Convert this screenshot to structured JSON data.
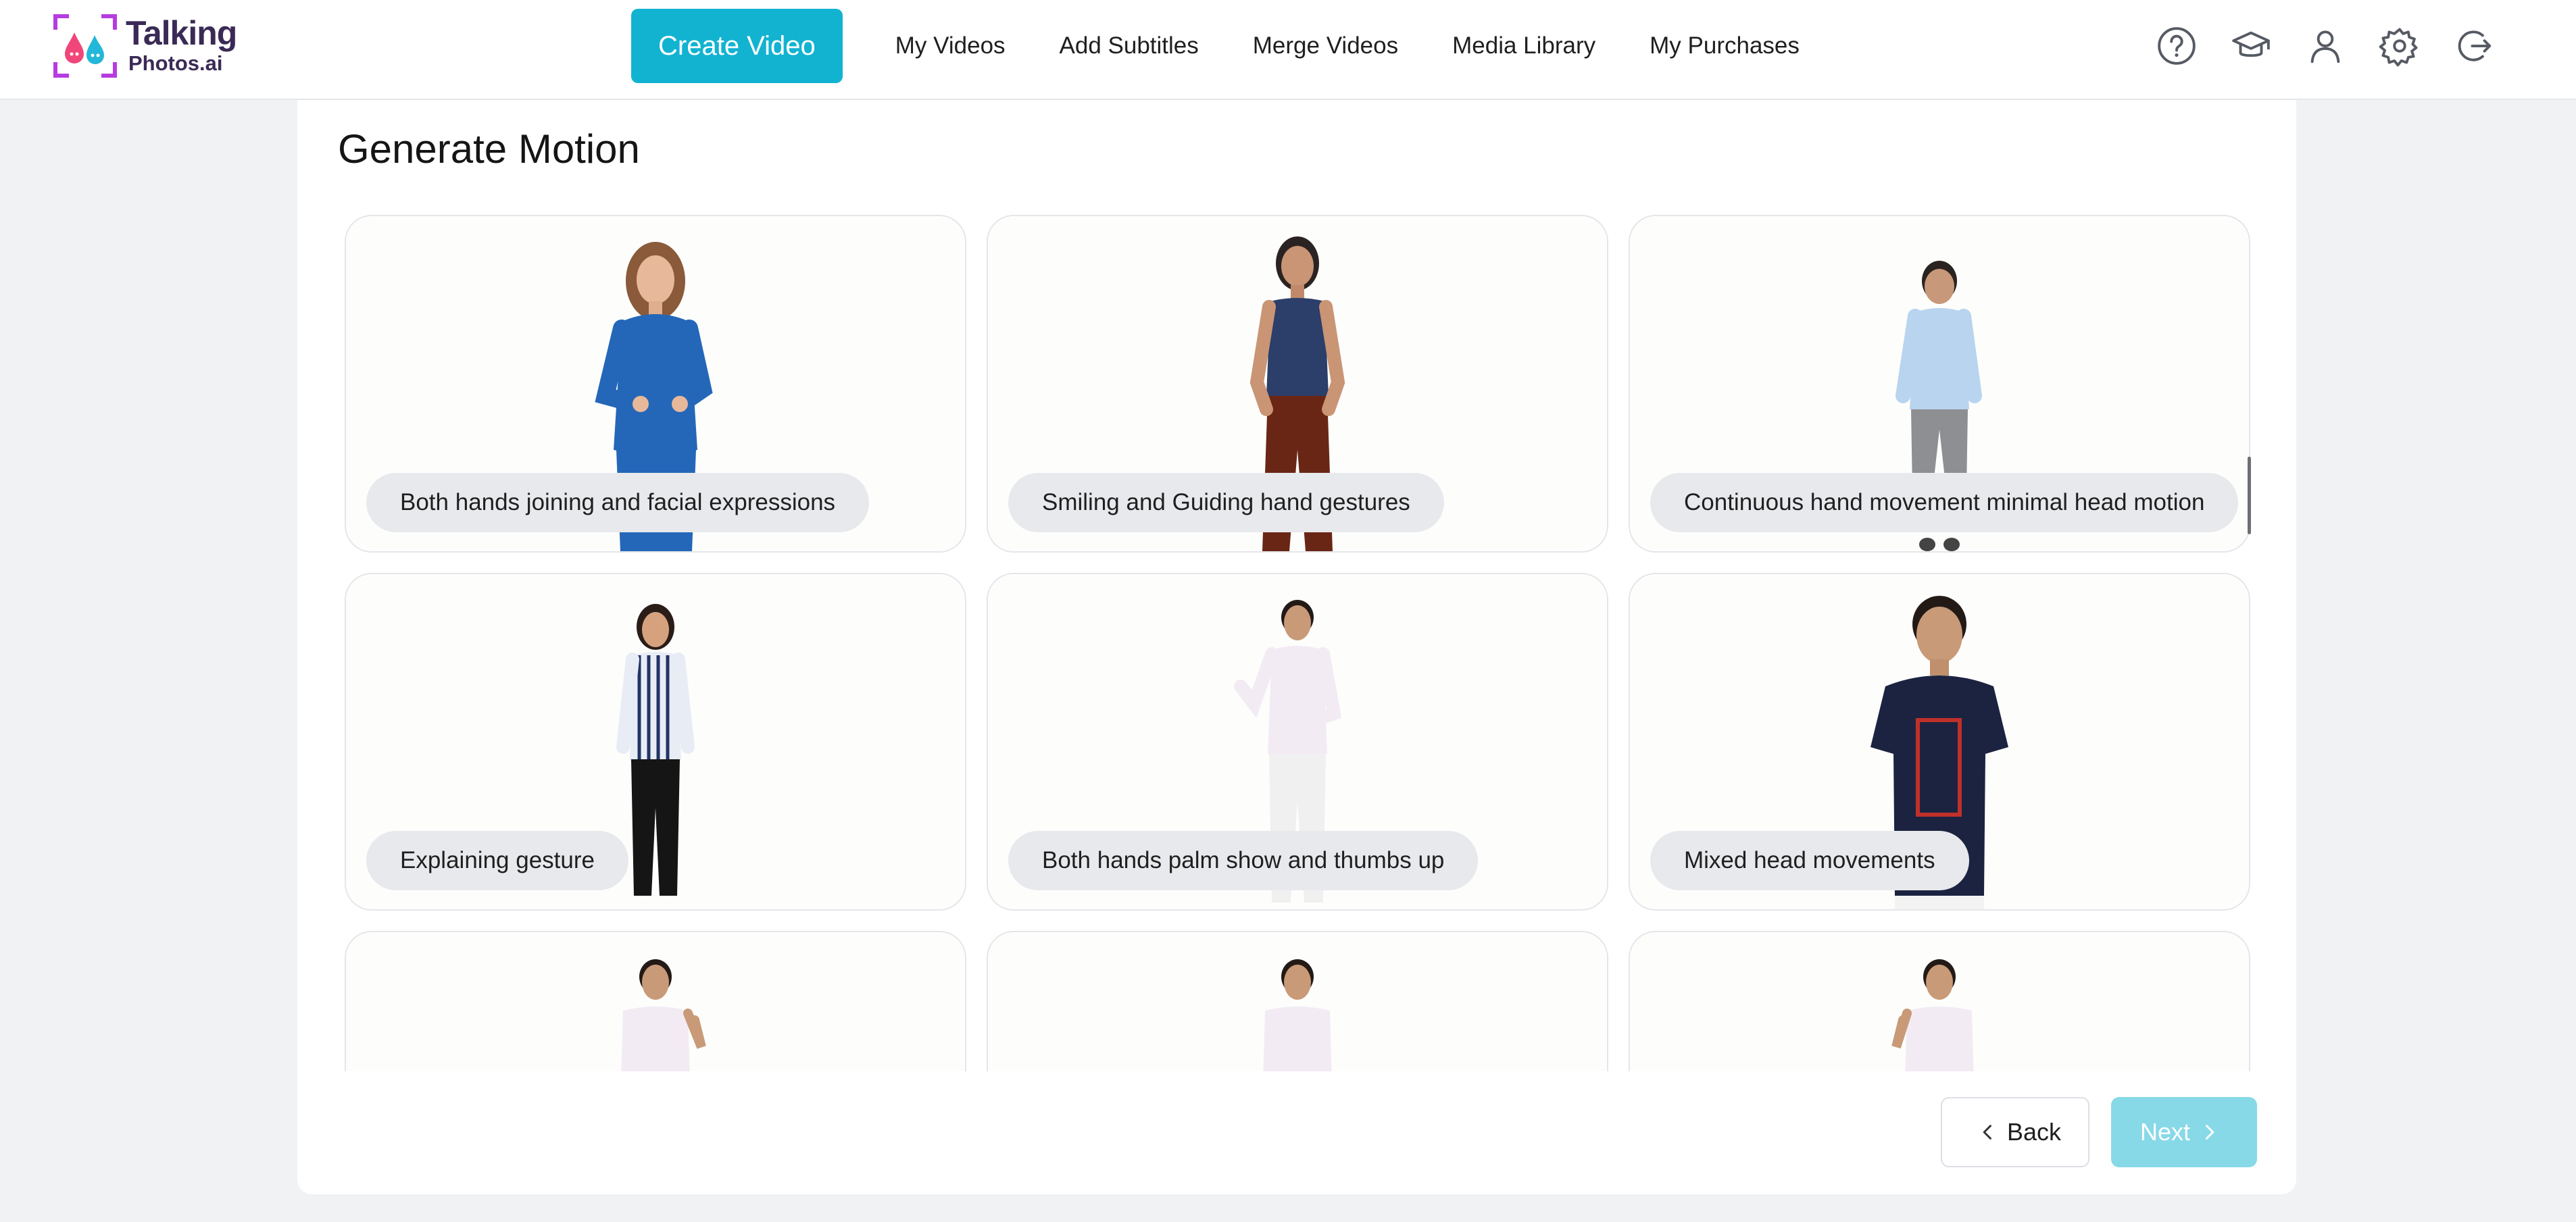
{
  "header": {
    "logo": {
      "line1": "Talking",
      "line2": "Photos.ai"
    },
    "nav": {
      "create_video": "Create Video",
      "my_videos": "My Videos",
      "add_subtitles": "Add Subtitles",
      "merge_videos": "Merge Videos",
      "media_library": "Media Library",
      "my_purchases": "My Purchases"
    },
    "icons": [
      "help-icon",
      "graduation-cap-icon",
      "user-icon",
      "gear-icon",
      "logout-icon"
    ]
  },
  "main": {
    "title": "Generate Motion",
    "cards": [
      {
        "label": "Both hands joining and facial expressions"
      },
      {
        "label": "Smiling and Guiding hand gestures"
      },
      {
        "label": "Continuous hand movement minimal head motion"
      },
      {
        "label": "Explaining gesture"
      },
      {
        "label": "Both hands palm show and thumbs up"
      },
      {
        "label": "Mixed head movements"
      },
      {
        "label": ""
      },
      {
        "label": ""
      },
      {
        "label": ""
      }
    ]
  },
  "footer": {
    "back_label": "Back",
    "next_label": "Next"
  },
  "colors": {
    "accent": "#12b3d1",
    "accent_disabled": "#87d9e8",
    "page_bg": "#f1f2f4",
    "chip_bg": "#e8e9ec"
  }
}
